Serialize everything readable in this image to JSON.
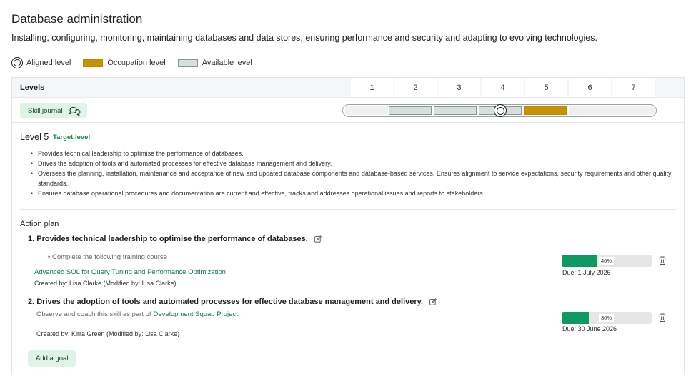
{
  "page": {
    "title": "Database administration",
    "subtitle": "Installing, configuring, monitoring, maintaining databases and data stores, ensuring performance and security and adapting to evolving technologies."
  },
  "legend": {
    "aligned": "Aligned level",
    "occupation": "Occupation level",
    "available": "Available level"
  },
  "colors": {
    "accent_green": "#0f9960",
    "occupation": "#c79100",
    "available": "#d5e0dc"
  },
  "levels": {
    "label": "Levels",
    "numbers": [
      "1",
      "2",
      "3",
      "4",
      "5",
      "6",
      "7"
    ],
    "aligned_level": 4,
    "occupation_level": 5,
    "available_levels": [
      2,
      3,
      4
    ]
  },
  "skill_journal": {
    "label": "Skill journal",
    "icon": "chat-bubbles-icon"
  },
  "level_detail": {
    "title": "Level 5",
    "badge": "Target level",
    "bullets": [
      "Provides technical leadership to optimise the performance of databases.",
      "Drives the adoption of tools and automated processes for effective database management and delivery.",
      "Oversees the planning, installation, maintenance and acceptance of new and updated database components and database-based services. Ensures alignment to service expectations, security requirements and other quality standards.",
      "Ensures database operational procedures and documentation are current and effective, tracks and addresses operational issues and reports to stakeholders."
    ]
  },
  "action_plan": {
    "title": "Action plan",
    "goals": [
      {
        "title": "1. Provides technical leadership to optimise the performance of databases.",
        "detail": "Complete the following training course",
        "link": "Advanced SQL for Query Tuning and Performance Optimization",
        "created": "Created by: Lisa Clarke  (Modified by: Lisa Clarke)",
        "progress": 40,
        "progress_label": "40%",
        "due": "Due: 1 July 2026"
      },
      {
        "title": "2. Drives the adoption of tools and automated processes for effective database management and delivery.",
        "detail": "Observe and coach this skill as part of",
        "link": "Development Squad Project.",
        "created": "Created by: Kirra Green  (Modified by: Lisa Clarke)",
        "progress": 30,
        "progress_label": "30%",
        "due": "Due: 30 June 2026"
      }
    ],
    "add_goal": "Add a goal"
  }
}
